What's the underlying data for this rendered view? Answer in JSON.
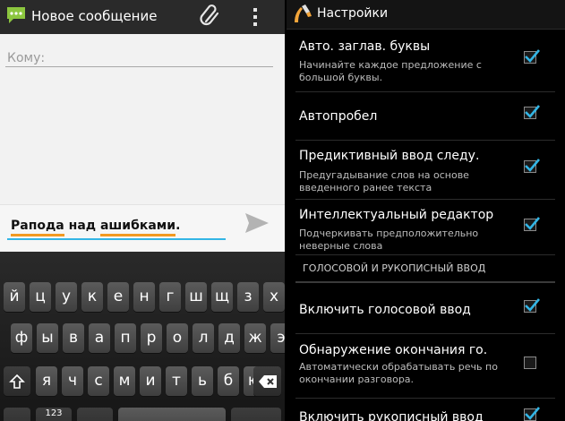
{
  "left": {
    "title": "Новое сообщение",
    "to_placeholder": "Кому:",
    "message_words": [
      "Рапода",
      " над ",
      "ашибками",
      "."
    ],
    "keyboard": {
      "row1": [
        "й",
        "ц",
        "у",
        "к",
        "е",
        "н",
        "г",
        "ш",
        "щ",
        "з",
        "х"
      ],
      "row2": [
        "ф",
        "ы",
        "в",
        "а",
        "п",
        "р",
        "о",
        "л",
        "д",
        "ж",
        "э"
      ],
      "row3": [
        "я",
        "ч",
        "с",
        "м",
        "и",
        "т",
        "ь",
        "б",
        "ю"
      ],
      "symbols_label": "123"
    }
  },
  "right": {
    "title": "Настройки",
    "prefs": [
      {
        "title": "Авто. заглав. буквы",
        "summary": [
          "Начинайте каждое предложение с",
          "большой буквы."
        ],
        "checked": true
      },
      {
        "title": "Автопробел",
        "summary": [],
        "checked": true
      },
      {
        "title": "Предиктивный ввод следу.",
        "summary": [
          "Предугадывание слов на основе",
          "введенного ранее текста"
        ],
        "checked": true
      },
      {
        "title": "Интеллектуальный редактор",
        "summary": [
          "Подчеркивать предположительно",
          "неверные слова"
        ],
        "checked": true
      }
    ],
    "category": "ГОЛОСОВОЙ И РУКОПИСНЫЙ ВВОД",
    "prefs2": [
      {
        "title": "Включить голосовой ввод",
        "summary": [],
        "checked": true
      },
      {
        "title": "Обнаружение окончания го.",
        "summary": [
          "Автоматически обрабатывать речь по",
          "окончании разговора."
        ],
        "checked": false
      },
      {
        "title": "Включить рукописный ввод",
        "summary": [],
        "checked": true
      }
    ]
  },
  "colors": {
    "accent": "#33b5e5",
    "error_underline": "#f29a22",
    "check": "#33b5e5"
  }
}
